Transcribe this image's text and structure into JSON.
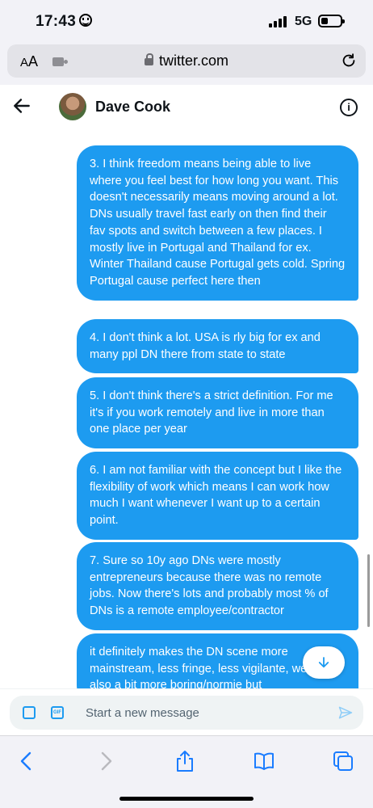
{
  "status_bar": {
    "time": "17:43",
    "network": "5G"
  },
  "browser": {
    "aa_small": "A",
    "aa_big": "A",
    "url": "twitter.com"
  },
  "header": {
    "name": "Dave Cook"
  },
  "messages": [
    {
      "text": "3. I think freedom means being able to live where you feel best for how long you want. This doesn't necessarily means moving around a lot. DNs usually travel fast early on then find their fav spots and switch between a few places. I mostly live in Portugal and Thailand for ex. Winter Thailand cause Portugal gets cold. Spring Portugal cause perfect here then"
    },
    {
      "text": "4. I don't think a lot. USA is rly big for ex and many ppl DN there from state to state"
    },
    {
      "text": "5. I don't think there's a strict definition. For me it's if you work remotely and live in more than one place per year"
    },
    {
      "text": "6. I am not familiar with the concept but I like the flexibility of work which means I can work how much I want whenever I want up to a certain point."
    },
    {
      "text": "7. Sure so 10y ago DNs were mostly entrepreneurs because there was no remote jobs. Now there's lots and probably most % of DNs is a remote employee/contractor"
    },
    {
      "text": "it definitely makes the DN scene more mainstream, less fringe, less vigilante, weird but also a bit more boring/normie but"
    }
  ],
  "composer": {
    "placeholder": "Start a new message",
    "gif_label": "GIF"
  },
  "colors": {
    "accent": "#1d9bf0",
    "bubble_text": "#ffffff",
    "chrome_bg": "#f2f2f7"
  },
  "icons": {
    "back": "arrow-left-icon",
    "info": "info-icon",
    "media": "image-icon",
    "gif": "gif-icon",
    "send": "send-icon",
    "scroll": "arrow-down-icon"
  }
}
